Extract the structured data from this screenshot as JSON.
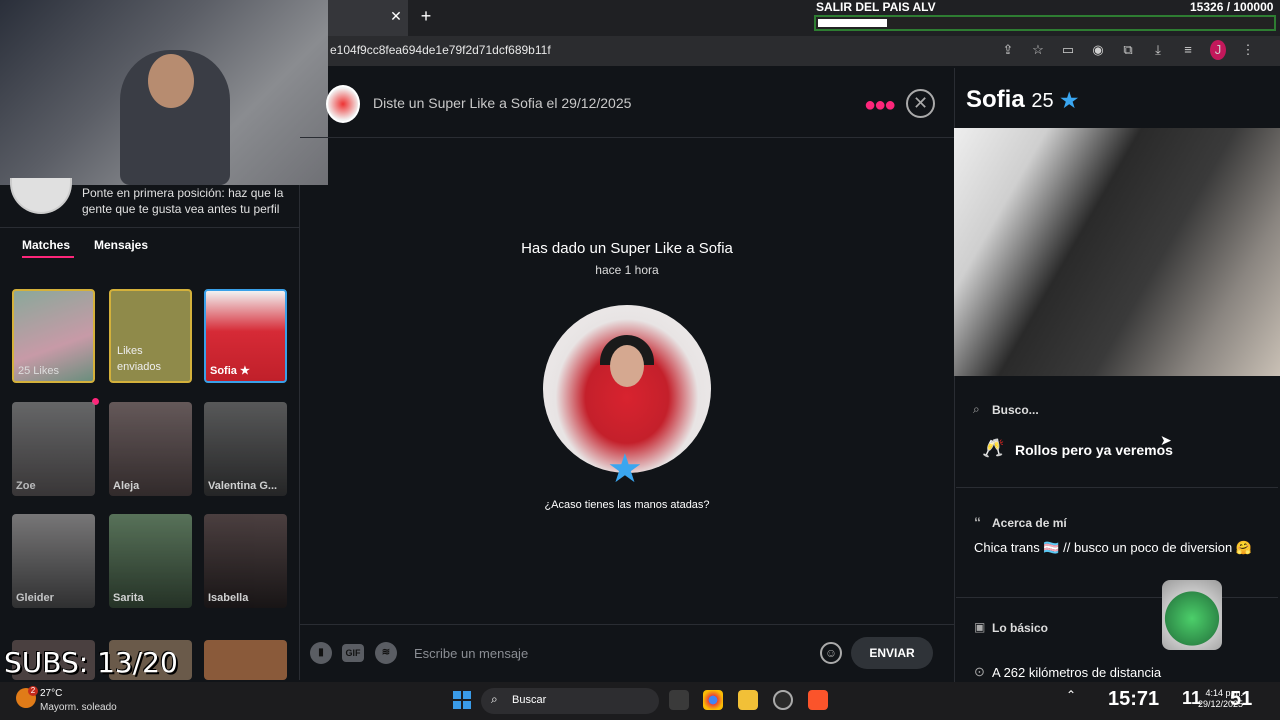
{
  "browser": {
    "url": "e104f9cc8fea694de1e79f2d71dcf689b11f",
    "profile_initial": "J"
  },
  "overlay": {
    "goal_title": "SALIR DEL PAIS ALV",
    "goal_count": "15326 / 100000",
    "goal_progress": 0.153,
    "subs": "SUBS: 13/20"
  },
  "sidebar": {
    "promo": "Ponte en primera posición: haz que la gente que te gusta vea antes tu perfil",
    "tabs": {
      "matches": "Matches",
      "mensajes": "Mensajes"
    },
    "cards": {
      "likes": "25 Likes",
      "sent": "Likes enviados",
      "sofia": "Sofia ★",
      "zoe": "Zoe",
      "aleja": "Aleja",
      "valentina": "Valentina G...",
      "gleider": "Gleider",
      "sarita": "Sarita",
      "isabella": "Isabella"
    }
  },
  "chat": {
    "header": "Diste un Super Like a Sofia el 29/12/2025",
    "super_like_title": "Has dado un Super Like a Sofia",
    "time": "hace 1 hora",
    "question": "¿Acaso tienes las manos atadas?",
    "input_placeholder": "Escribe un mensaje",
    "send": "ENVIAR",
    "gif": "GIF"
  },
  "profile": {
    "name": "Sofia",
    "age": "25",
    "busco_label": "Busco...",
    "busco_value": "Rollos pero ya veremos",
    "acerca_label": "Acerca de mí",
    "acerca_text": "Chica trans 🏳️‍⚧️ // busco un poco de diversion 🤗",
    "basico_label": "Lo básico",
    "distance": "A 262 kilómetros de distancia"
  },
  "taskbar": {
    "temp": "27°C",
    "weather": "Mayorm. soleado",
    "weather_badge": "2",
    "search": "Buscar",
    "clock_big": "15:71",
    "clock_mid": "11",
    "time": "4:14 p.m.",
    "date": "29/12/2025",
    "secs": "51"
  }
}
